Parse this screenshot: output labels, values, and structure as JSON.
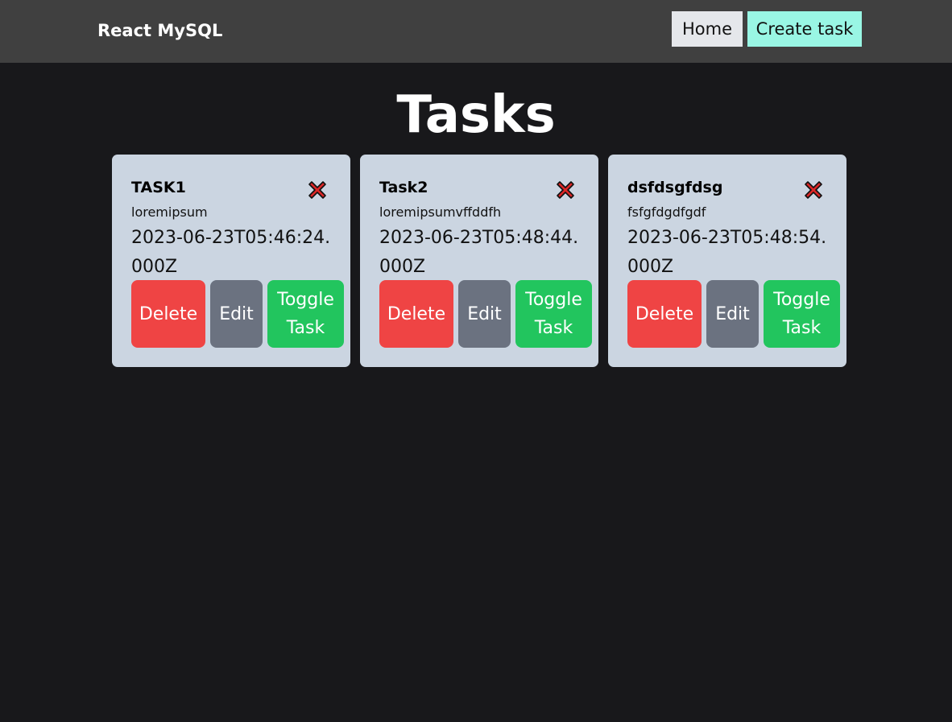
{
  "navbar": {
    "brand": "React MySQL",
    "home_label": "Home",
    "create_label": "Create task",
    "colors": {
      "background": "#404040",
      "home_bg": "#e5e7eb",
      "create_bg": "#99f6e4"
    }
  },
  "page": {
    "title": "Tasks",
    "background": "#18181b"
  },
  "tasks": [
    {
      "title": "TASK1",
      "description": "loremipsum",
      "created_at": "2023-06-23T05:46:24.000Z",
      "icon": "close-icon",
      "delete_label": "Delete",
      "edit_label": "Edit",
      "toggle_label": "Toggle Task"
    },
    {
      "title": "Task2",
      "description": "loremipsumvffddfh",
      "created_at": "2023-06-23T05:48:44.000Z",
      "icon": "close-icon",
      "delete_label": "Delete",
      "edit_label": "Edit",
      "toggle_label": "Toggle Task"
    },
    {
      "title": "dsfdsgfdsg",
      "description": "fsfgfdgdfgdf",
      "created_at": "2023-06-23T05:48:54.000Z",
      "icon": "close-icon",
      "delete_label": "Delete",
      "edit_label": "Edit",
      "toggle_label": "Toggle Task"
    }
  ],
  "colors": {
    "card_bg": "#cbd5e1",
    "delete": "#ef4444",
    "edit": "#6b7280",
    "toggle": "#22c55e",
    "close_icon": "#dc2626"
  }
}
